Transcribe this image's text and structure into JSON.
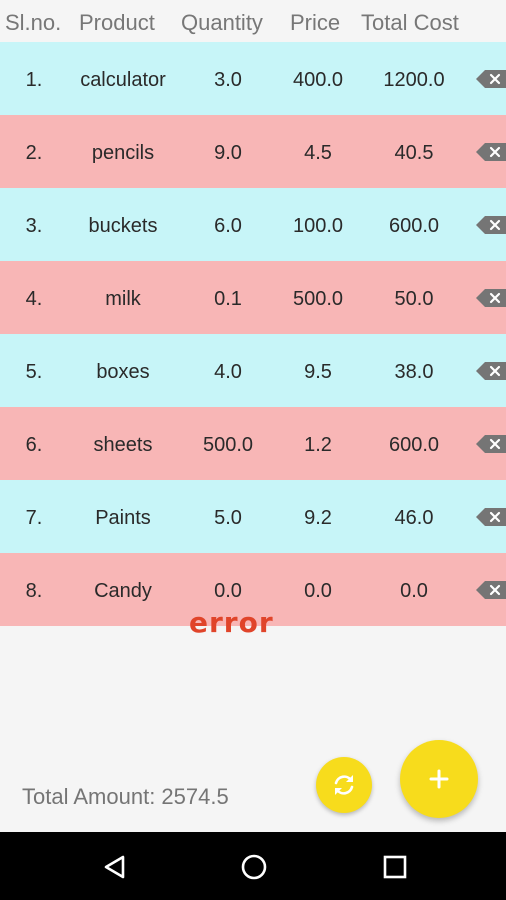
{
  "header": {
    "slno": "Sl.no.",
    "product": "Product",
    "quantity": "Quantity",
    "price": "Price",
    "total_cost": "Total Cost"
  },
  "rows": [
    {
      "no": "1.",
      "product": "calculator",
      "quantity": "3.0",
      "price": "400.0",
      "total": "1200.0",
      "color": "#c7f5f8"
    },
    {
      "no": "2.",
      "product": "pencils",
      "quantity": "9.0",
      "price": "4.5",
      "total": "40.5",
      "color": "#f8b6b6"
    },
    {
      "no": "3.",
      "product": "buckets",
      "quantity": "6.0",
      "price": "100.0",
      "total": "600.0",
      "color": "#c7f5f8"
    },
    {
      "no": "4.",
      "product": "milk",
      "quantity": "0.1",
      "price": "500.0",
      "total": "50.0",
      "color": "#f8b6b6"
    },
    {
      "no": "5.",
      "product": "boxes",
      "quantity": "4.0",
      "price": "9.5",
      "total": "38.0",
      "color": "#c7f5f8"
    },
    {
      "no": "6.",
      "product": "sheets",
      "quantity": "500.0",
      "price": "1.2",
      "total": "600.0",
      "color": "#f8b6b6"
    },
    {
      "no": "7.",
      "product": "Paints",
      "quantity": "5.0",
      "price": "9.2",
      "total": "46.0",
      "color": "#c7f5f8"
    },
    {
      "no": "8.",
      "product": "Candy",
      "quantity": "0.0",
      "price": "0.0",
      "total": "0.0",
      "color": "#f8b6b6"
    }
  ],
  "error_text": "error",
  "total_amount": "Total Amount: 2574.5",
  "icons": {
    "row_delete": "backspace-icon",
    "refresh": "refresh-icon",
    "add": "plus-icon",
    "nav_back": "back-triangle-icon",
    "nav_home": "home-circle-icon",
    "nav_recent": "recent-square-icon"
  },
  "colors": {
    "row_cyan": "#c7f5f8",
    "row_pink": "#f8b6b6",
    "fab_yellow": "#f7dc1c",
    "error_red": "#e0442a"
  }
}
